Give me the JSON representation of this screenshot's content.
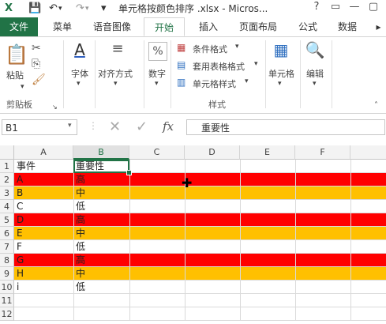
{
  "titlebar": {
    "title": "单元格按颜色排序 .xlsx - Micros...",
    "controls": [
      "?",
      "▭",
      "—",
      "▢"
    ]
  },
  "tabs": [
    "文件",
    "菜单",
    "语音图像",
    "开始",
    "插入",
    "页面布局",
    "公式",
    "数据"
  ],
  "active_tab": "开始",
  "ribbon": {
    "clipboard": {
      "paste": "粘贴",
      "group": "剪贴板"
    },
    "font": {
      "label": "字体"
    },
    "align": {
      "label": "对齐方式"
    },
    "number": {
      "label": "数字",
      "icon_text": "%"
    },
    "styles": {
      "cond": "条件格式",
      "table": "套用表格格式",
      "cell": "单元格样式",
      "group": "样式"
    },
    "cells": {
      "label": "单元格"
    },
    "edit": {
      "label": "编辑"
    }
  },
  "formula_bar": {
    "namebox": "B1",
    "fx": "fx",
    "content": "重要性"
  },
  "sheet": {
    "columns": [
      "A",
      "B",
      "C",
      "D",
      "E",
      "F"
    ],
    "selected_col": "B",
    "row_numbers": [
      "1",
      "2",
      "3",
      "4",
      "5",
      "6",
      "7",
      "8",
      "9",
      "10",
      "11",
      "12"
    ],
    "rows": [
      {
        "a": "事件",
        "b": "重要性",
        "fill": ""
      },
      {
        "a": "A",
        "b": "高",
        "fill": "#ff0000"
      },
      {
        "a": "B",
        "b": "中",
        "fill": "#ffc000"
      },
      {
        "a": "C",
        "b": "低",
        "fill": ""
      },
      {
        "a": "D",
        "b": "高",
        "fill": "#ff0000"
      },
      {
        "a": "E",
        "b": "中",
        "fill": "#ffc000"
      },
      {
        "a": "F",
        "b": "低",
        "fill": ""
      },
      {
        "a": "G",
        "b": "高",
        "fill": "#ff0000"
      },
      {
        "a": "H",
        "b": "中",
        "fill": "#ffc000"
      },
      {
        "a": "i",
        "b": "低",
        "fill": ""
      },
      {
        "a": "",
        "b": "",
        "fill": ""
      },
      {
        "a": "",
        "b": "",
        "fill": ""
      }
    ]
  },
  "colors": {
    "accent": "#217346",
    "red": "#ff0000",
    "orange": "#ffc000"
  }
}
